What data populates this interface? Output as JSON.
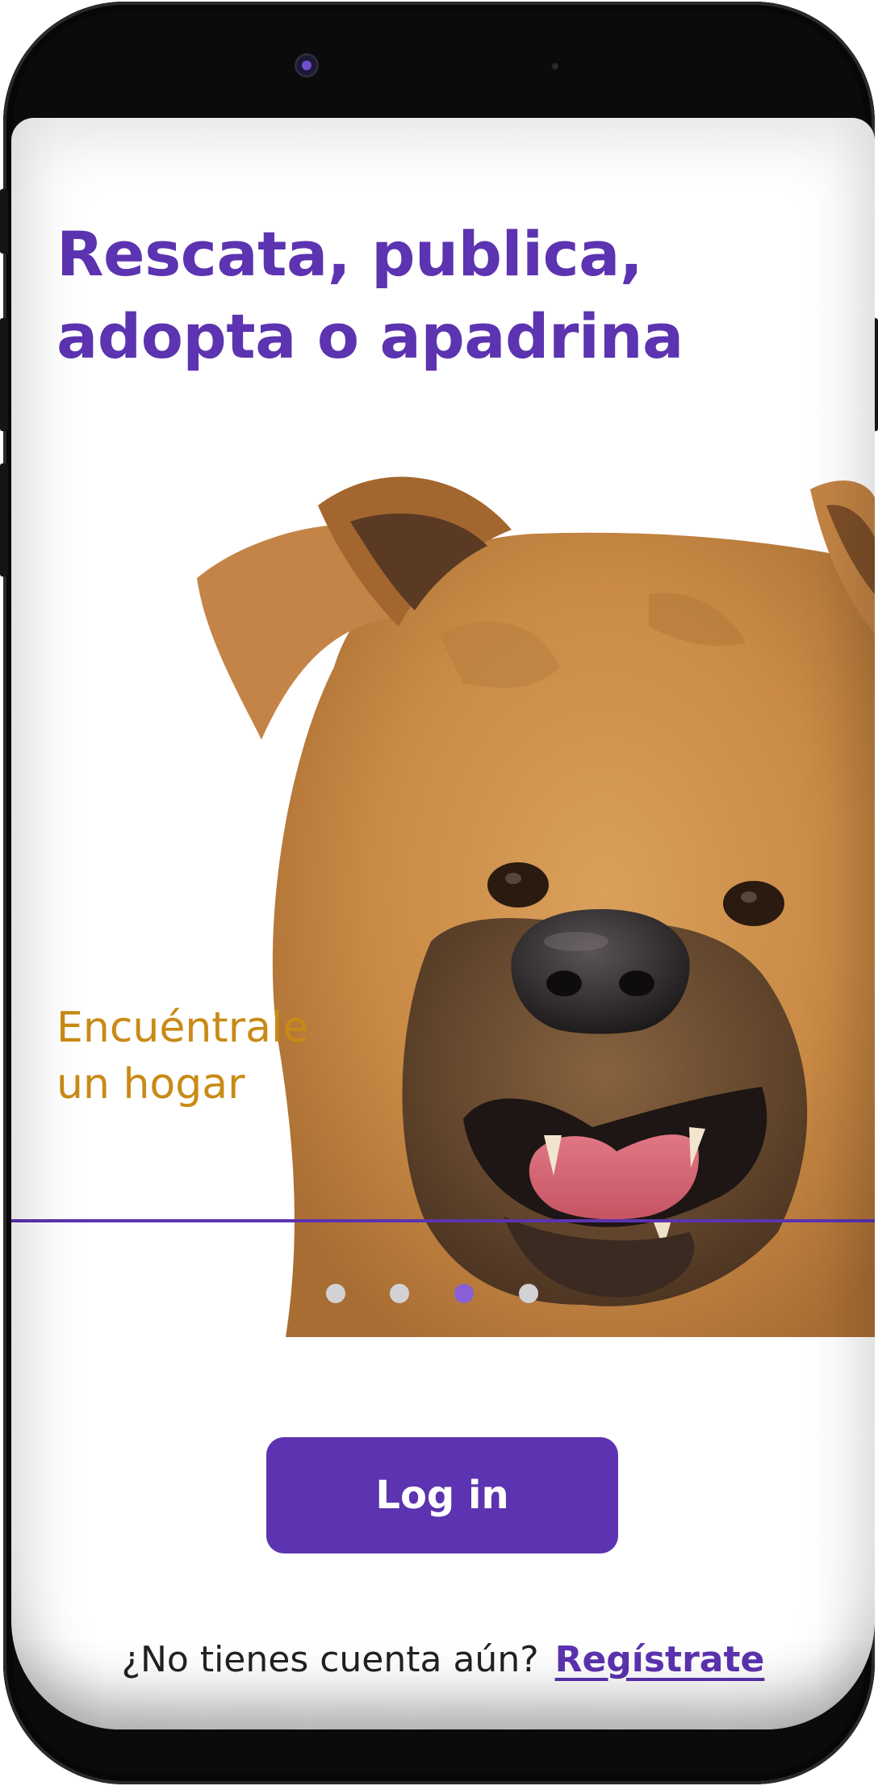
{
  "onboarding": {
    "headline_line1": "Rescata, publica,",
    "headline_line2": "adopta o apadrina",
    "tagline_line1": "Encuéntrale",
    "tagline_line2": "un hogar",
    "hero_image": "dog-photo"
  },
  "pager": {
    "total_pages": 4,
    "active_page": 3,
    "active_color": "#8a5fd6",
    "inactive_color": "#d2d2d4"
  },
  "actions": {
    "login_label": "Log in",
    "no_account_text": "¿No tienes cuenta aún?",
    "register_link": "Regístrate"
  },
  "colors": {
    "brand_purple": "#5c33b0",
    "tagline_orange": "#c98a16"
  }
}
